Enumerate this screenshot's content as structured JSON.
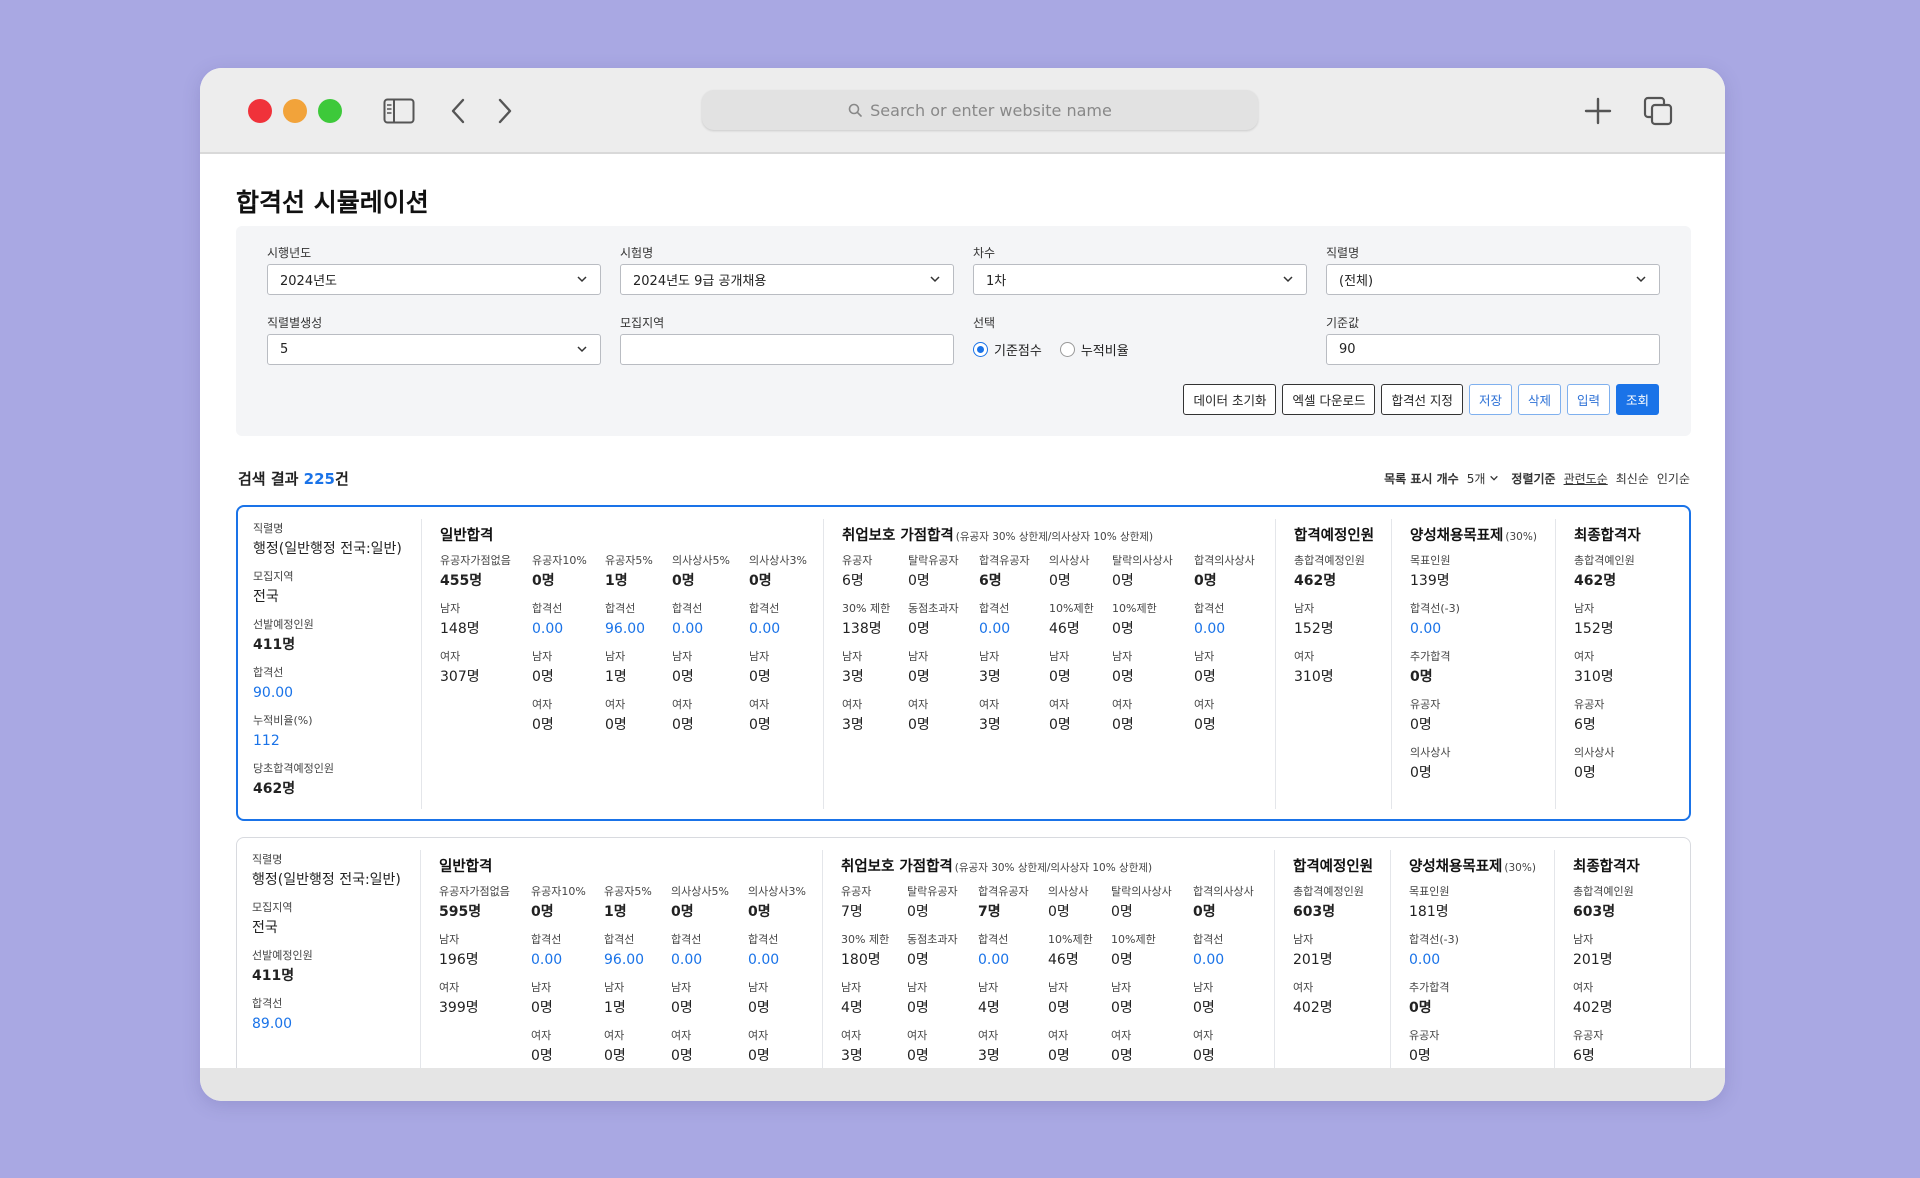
{
  "browser": {
    "search_placeholder": "Search or enter website name",
    "icons": [
      "sidebar-icon",
      "back-icon",
      "forward-icon",
      "search-icon",
      "plus-icon",
      "tabs-icon"
    ]
  },
  "page": {
    "title": "합격선 시뮬레이션"
  },
  "filters": {
    "year": {
      "label": "시행년도",
      "value": "2024년도"
    },
    "exam": {
      "label": "시험명",
      "value": "2024년도 9급 공개채용"
    },
    "round": {
      "label": "차수",
      "value": "1차"
    },
    "job": {
      "label": "직렬명",
      "value": "(전체)"
    },
    "gender": {
      "label": "직렬별생성",
      "value": "5"
    },
    "region": {
      "label": "모집지역",
      "value": ""
    },
    "choice": {
      "label": "선택",
      "options": [
        "기준점수",
        "누적비율"
      ],
      "selected": "기준점수"
    },
    "base": {
      "label": "기준값",
      "value": "90"
    }
  },
  "buttons": {
    "reset": "데이터 초기화",
    "excel": "엑셀 다운로드",
    "setline": "합격선 지정",
    "save": "저장",
    "delete": "삭제",
    "input": "입력",
    "search": "조회"
  },
  "results": {
    "label_prefix": "검색 결과 ",
    "count": "225",
    "label_suffix": "건",
    "list_count_label": "목록 표시 개수",
    "list_count_value": "5개",
    "sort_label": "정렬기준",
    "sort_options": [
      "관련도순",
      "최신순",
      "인기순"
    ]
  },
  "labels": {
    "left": [
      "직렬명",
      "모집지역",
      "선발예정인원",
      "합격선",
      "누적비율(%)",
      "당초합격예정인원"
    ],
    "general_title": "일반합격",
    "general_cols": [
      "유공자가점없음",
      "유공자10%",
      "유공자5%",
      "의사상사5%",
      "의사상사3%"
    ],
    "general_row2": [
      "남자",
      "합격선",
      "합격선",
      "합격선",
      "합격선"
    ],
    "general_row3": [
      "여자",
      "남자",
      "남자",
      "남자",
      "남자"
    ],
    "general_row4": [
      "",
      "여자",
      "여자",
      "여자",
      "여자"
    ],
    "emp_title": "취업보호 가점합격",
    "emp_sub": "(유공자 30% 상한제/의사상자 10% 상한제)",
    "emp_cols": [
      "유공자",
      "탈락유공자",
      "합격유공자",
      "의사상사",
      "탈락의사상사",
      "합격의사상사"
    ],
    "emp_row2": [
      "30% 제한",
      "동점초과자",
      "합격선",
      "10%제한",
      "10%제한",
      "합격선"
    ],
    "emp_row3": [
      "남자",
      "남자",
      "남자",
      "남자",
      "남자",
      "남자"
    ],
    "emp_row4": [
      "여자",
      "여자",
      "여자",
      "여자",
      "여자",
      "여자"
    ],
    "plan_title": "합격예정인원",
    "plan_labels": [
      "총합격예정인원",
      "남자",
      "여자"
    ],
    "gender_title": "양성채용목표제",
    "gender_sub": "(30%)",
    "gender_labels": [
      "목표인원",
      "합격선(-3)",
      "추가합격",
      "유공자",
      "의사상사"
    ],
    "final_title": "최종합격자",
    "final_labels": [
      "총합격예인원",
      "남자",
      "여자",
      "유공자",
      "의사상사"
    ]
  },
  "cards": [
    {
      "left": [
        "행정(일반행정 전국:일반)",
        "전국",
        "411명",
        "90.00",
        "112",
        "462명"
      ],
      "general": [
        [
          "455명",
          "0명",
          "1명",
          "0명",
          "0명"
        ],
        [
          "148명",
          "0.00",
          "96.00",
          "0.00",
          "0.00"
        ],
        [
          "307명",
          "0명",
          "1명",
          "0명",
          "0명"
        ],
        [
          "",
          "0명",
          "0명",
          "0명",
          "0명"
        ]
      ],
      "emp": [
        [
          "6명",
          "0명",
          "6명",
          "0명",
          "0명",
          "0명"
        ],
        [
          "138명",
          "0명",
          "0.00",
          "46명",
          "0명",
          "0.00"
        ],
        [
          "3명",
          "0명",
          "3명",
          "0명",
          "0명",
          "0명"
        ],
        [
          "3명",
          "0명",
          "3명",
          "0명",
          "0명",
          "0명"
        ]
      ],
      "plan": [
        "462명",
        "152명",
        "310명"
      ],
      "gender": [
        "139명",
        "0.00",
        "0명",
        "0명",
        "0명"
      ],
      "final": [
        "462명",
        "152명",
        "310명",
        "6명",
        "0명"
      ]
    },
    {
      "left": [
        "행정(일반행정 전국:일반)",
        "전국",
        "411명",
        "89.00",
        "",
        ""
      ],
      "general": [
        [
          "595명",
          "0명",
          "1명",
          "0명",
          "0명"
        ],
        [
          "196명",
          "0.00",
          "96.00",
          "0.00",
          "0.00"
        ],
        [
          "399명",
          "0명",
          "1명",
          "0명",
          "0명"
        ],
        [
          "",
          "0명",
          "0명",
          "0명",
          "0명"
        ]
      ],
      "emp": [
        [
          "7명",
          "0명",
          "7명",
          "0명",
          "0명",
          "0명"
        ],
        [
          "180명",
          "0명",
          "0.00",
          "46명",
          "0명",
          "0.00"
        ],
        [
          "4명",
          "0명",
          "4명",
          "0명",
          "0명",
          "0명"
        ],
        [
          "3명",
          "0명",
          "3명",
          "0명",
          "0명",
          "0명"
        ]
      ],
      "plan": [
        "603명",
        "201명",
        "402명"
      ],
      "gender": [
        "181명",
        "0.00",
        "0명",
        "0명",
        ""
      ],
      "final": [
        "603명",
        "201명",
        "402명",
        "6명",
        ""
      ]
    }
  ]
}
